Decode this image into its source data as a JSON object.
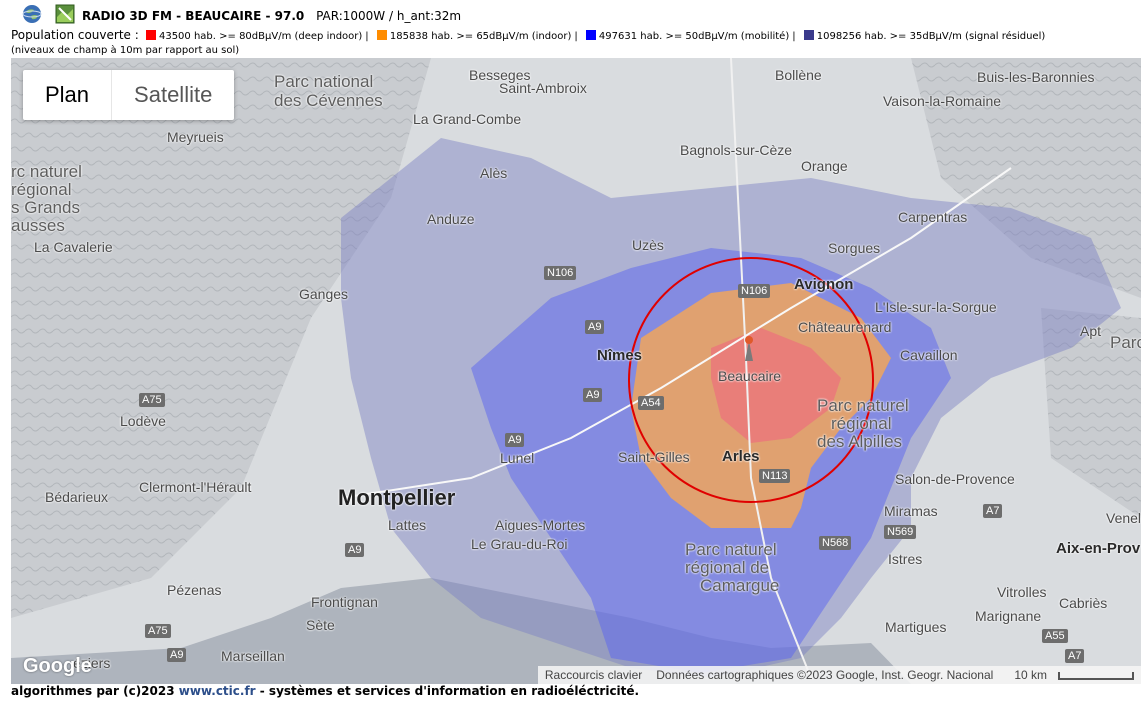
{
  "header": {
    "title": "RADIO 3D FM - BEAUCAIRE - 97.0",
    "params": "PAR:1000W / h_ant:32m",
    "population_label": "Population couverte :",
    "coverage": [
      {
        "color": "#ff0000",
        "text": "43500 hab. >= 80dBµV/m (deep indoor)"
      },
      {
        "color": "#ff8c00",
        "text": "185838 hab. >= 65dBµV/m (indoor)"
      },
      {
        "color": "#0000ff",
        "text": "497631 hab. >= 50dBµV/m (mobilité)"
      },
      {
        "color": "#3a3a8c",
        "text": "1098256 hab. >= 35dBµV/m (signal résiduel)"
      }
    ],
    "note": "(niveaux de champ à 10m par rapport au sol)"
  },
  "maptype": {
    "plan": "Plan",
    "satellite": "Satellite",
    "active": "plan"
  },
  "places": [
    {
      "id": "besseges",
      "name": "Besseges",
      "kind": "town"
    },
    {
      "id": "bollene",
      "name": "Bollène",
      "kind": "town"
    },
    {
      "id": "buis",
      "name": "Buis-les-Baronnies",
      "kind": "town"
    },
    {
      "id": "saint-ambroix",
      "name": "Saint-Ambroix",
      "kind": "town"
    },
    {
      "id": "vaison",
      "name": "Vaison-la-Romaine",
      "kind": "town"
    },
    {
      "id": "cevennes1",
      "name": "Parc national",
      "kind": "park"
    },
    {
      "id": "cevennes2",
      "name": "des Cévennes",
      "kind": "park"
    },
    {
      "id": "grand-combe",
      "name": "La Grand-Combe",
      "kind": "town"
    },
    {
      "id": "meyrueis",
      "name": "Meyrueis",
      "kind": "town"
    },
    {
      "id": "bagnols",
      "name": "Bagnols-sur-Cèze",
      "kind": "town"
    },
    {
      "id": "orange",
      "name": "Orange",
      "kind": "town"
    },
    {
      "id": "ales",
      "name": "Alès",
      "kind": "town"
    },
    {
      "id": "causses1",
      "name": "rc naturel",
      "kind": "park"
    },
    {
      "id": "causses2",
      "name": "régional",
      "kind": "park"
    },
    {
      "id": "causses3",
      "name": "s Grands",
      "kind": "park"
    },
    {
      "id": "causses4",
      "name": "ausses",
      "kind": "park"
    },
    {
      "id": "carpentras",
      "name": "Carpentras",
      "kind": "town"
    },
    {
      "id": "anduze",
      "name": "Anduze",
      "kind": "town"
    },
    {
      "id": "cavalerie",
      "name": "La Cavalerie",
      "kind": "town"
    },
    {
      "id": "uzes",
      "name": "Uzès",
      "kind": "town"
    },
    {
      "id": "sorgues",
      "name": "Sorgues",
      "kind": "town"
    },
    {
      "id": "ganges",
      "name": "Ganges",
      "kind": "town"
    },
    {
      "id": "avignon",
      "name": "Avignon",
      "kind": "city"
    },
    {
      "id": "isle",
      "name": "L'Isle-sur-la-Sorgue",
      "kind": "town"
    },
    {
      "id": "apt",
      "name": "Apt",
      "kind": "town"
    },
    {
      "id": "chateaurenard",
      "name": "Châteaurenard",
      "kind": "town"
    },
    {
      "id": "nimes",
      "name": "Nîmes",
      "kind": "city"
    },
    {
      "id": "cavaillon",
      "name": "Cavaillon",
      "kind": "town"
    },
    {
      "id": "beaucaire",
      "name": "Beaucaire",
      "kind": "town"
    },
    {
      "id": "alpilles1",
      "name": "Parc naturel",
      "kind": "park"
    },
    {
      "id": "alpilles2",
      "name": "régional",
      "kind": "park"
    },
    {
      "id": "alpilles3",
      "name": "des Alpilles",
      "kind": "park"
    },
    {
      "id": "lodeve",
      "name": "Lodève",
      "kind": "town"
    },
    {
      "id": "lunel",
      "name": "Lunel",
      "kind": "town"
    },
    {
      "id": "saint-gilles",
      "name": "Saint-Gilles",
      "kind": "town"
    },
    {
      "id": "arles",
      "name": "Arles",
      "kind": "city"
    },
    {
      "id": "bedarieux",
      "name": "Bédarieux",
      "kind": "town"
    },
    {
      "id": "clermont",
      "name": "Clermont-l'Hérault",
      "kind": "town"
    },
    {
      "id": "salon",
      "name": "Salon-de-Provence",
      "kind": "town"
    },
    {
      "id": "montpellier",
      "name": "Montpellier",
      "kind": "metro"
    },
    {
      "id": "lattes",
      "name": "Lattes",
      "kind": "town"
    },
    {
      "id": "aigues",
      "name": "Aigues-Mortes",
      "kind": "town"
    },
    {
      "id": "miramas",
      "name": "Miramas",
      "kind": "town"
    },
    {
      "id": "grau",
      "name": "Le Grau-du-Roi",
      "kind": "town"
    },
    {
      "id": "camargue1",
      "name": "Parc naturel",
      "kind": "park"
    },
    {
      "id": "camargue2",
      "name": "régional de",
      "kind": "park"
    },
    {
      "id": "camargue3",
      "name": "Camargue",
      "kind": "park"
    },
    {
      "id": "aix",
      "name": "Aix-en-Prov",
      "kind": "city"
    },
    {
      "id": "istres",
      "name": "Istres",
      "kind": "town"
    },
    {
      "id": "pezenas",
      "name": "Pézenas",
      "kind": "town"
    },
    {
      "id": "vitrolles",
      "name": "Vitrolles",
      "kind": "town"
    },
    {
      "id": "frontignan",
      "name": "Frontignan",
      "kind": "town"
    },
    {
      "id": "cabries",
      "name": "Cabriès",
      "kind": "town"
    },
    {
      "id": "marignane",
      "name": "Marignane",
      "kind": "town"
    },
    {
      "id": "sete",
      "name": "Sète",
      "kind": "town"
    },
    {
      "id": "martigues",
      "name": "Martigues",
      "kind": "town"
    },
    {
      "id": "marseillan",
      "name": "Marseillan",
      "kind": "town"
    },
    {
      "id": "beziers",
      "name": "éziers",
      "kind": "town"
    },
    {
      "id": "venel",
      "name": "Venel",
      "kind": "town"
    },
    {
      "id": "parc-r",
      "name": "Parc",
      "kind": "park"
    }
  ],
  "roads": [
    "N106",
    "A9",
    "N106",
    "A9",
    "A54",
    "A75",
    "A9",
    "N113",
    "N569",
    "N568",
    "A7",
    "A9",
    "A75",
    "A9",
    "A55",
    "A7"
  ],
  "attribution": {
    "shortcuts": "Raccourcis clavier",
    "data": "Données cartographiques ©2023 Google, Inst. Geogr. Nacional",
    "scale": "10 km"
  },
  "google_logo": "Google",
  "footer": {
    "prefix": "algorithmes par (c)2023 ",
    "site": "www.ctic.fr",
    "suffix": " - systèmes et services d'information en radioéléctricité."
  }
}
